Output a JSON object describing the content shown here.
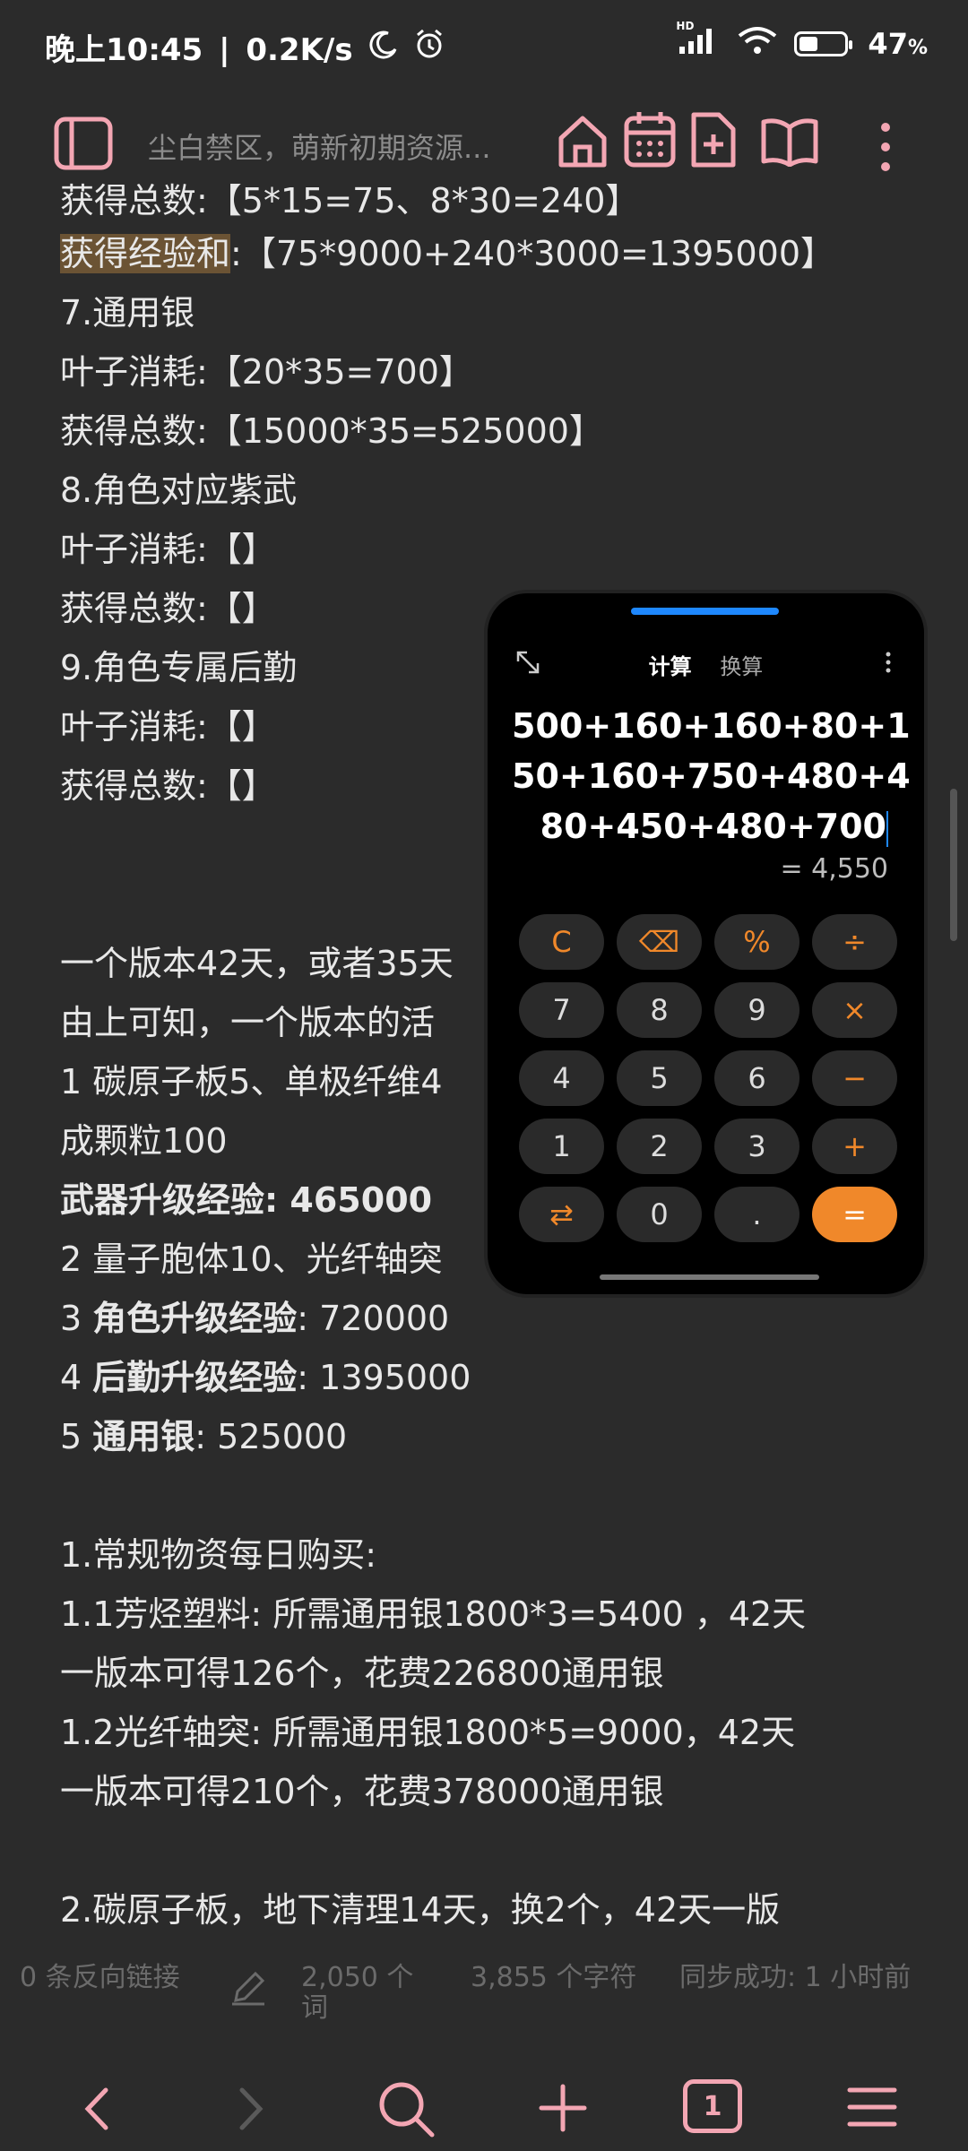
{
  "status": {
    "time": "晚上10:45",
    "separator": "|",
    "network_speed": "0.2K/s",
    "battery": "47",
    "battery_unit": "%",
    "battery_level": 0.47,
    "signal_badge": "HD"
  },
  "toolbar": {
    "title": "尘白禁区，萌新初期资源..."
  },
  "document": {
    "lines": [
      "获得总数:【5*15=75、8*30=240】",
      "获得经验和",
      ":【75*9000+240*3000=1395000】",
      "7.通用银",
      "叶子消耗:【20*35=700】",
      "获得总数:【15000*35=525000】",
      "8.角色对应紫武",
      "叶子消耗:【】",
      "获得总数:【】",
      "9.角色专属后勤",
      "叶子消耗:【】",
      "获得总数:【】",
      "一个版本42天，或者35天",
      "由上可知，一个版本的活",
      "1   碳原子板5、单极纤维4",
      "成颗粒100",
      "武器升级经验: 465000",
      "2   量子胞体10、光纤轴突",
      "3   ",
      "角色升级经验",
      ": 720000",
      "4   ",
      "后勤升级经验",
      ": 1395000",
      "5   ",
      "通用银",
      ": 525000",
      "1.常规物资每日购买:",
      "1.1芳烃塑料: 所需通用银1800*3=5400 ，42天",
      "一版本可得126个，花费226800通用银",
      "1.2光纤轴突: 所需通用银1800*5=9000，42天",
      "一版本可得210个，花费378000通用银",
      "2.碳原子板，地下清理14天，换2个，42天一版"
    ]
  },
  "footer": {
    "backlinks": "0 条反向链接",
    "words": "2,050 个词",
    "chars": "3,855 个字符",
    "sync": "同步成功: 1 小时前"
  },
  "bottom_nav": {
    "tab_count": "1"
  },
  "calculator": {
    "tab_calc": "计算",
    "tab_convert": "换算",
    "expression": [
      "500+160+160+80+1",
      "50+160+750+480+4",
      "80+450+480+700"
    ],
    "result": "= 4,550",
    "keys": [
      "C",
      "⌫",
      "%",
      "÷",
      "7",
      "8",
      "9",
      "×",
      "4",
      "5",
      "6",
      "−",
      "1",
      "2",
      "3",
      "+",
      "⇄",
      "0",
      ".",
      "="
    ]
  },
  "colors": {
    "accent_pink": "#f3a6b3",
    "calc_orange": "#f0882a",
    "highlight": "#6b5334",
    "calc_handle": "#1e88ff"
  }
}
